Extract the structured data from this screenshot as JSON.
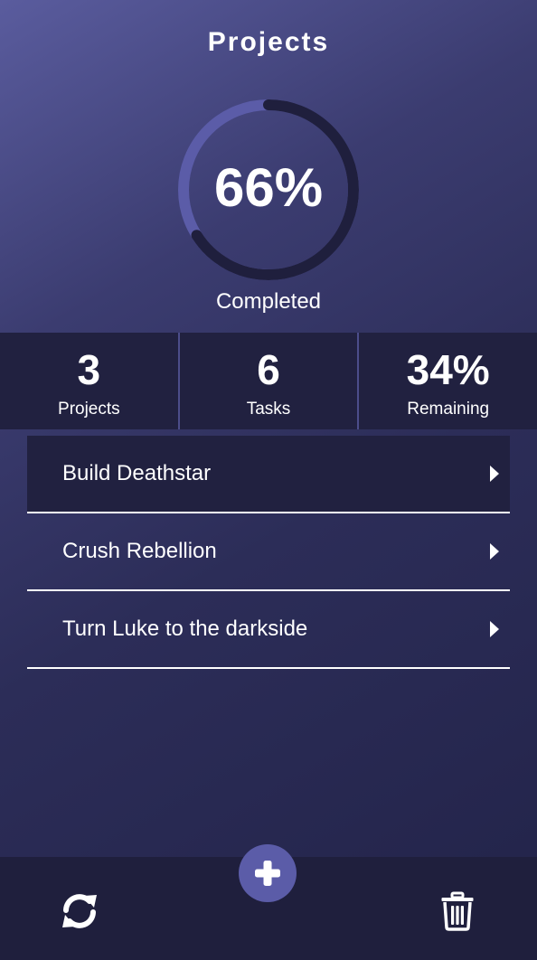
{
  "header": {
    "title": "Projects"
  },
  "progress": {
    "completed_fraction": 0.66,
    "percent_label": "66%",
    "caption": "Completed",
    "colors": {
      "track": "#5b5ca8",
      "fill": "#1f1f3d"
    }
  },
  "stats": [
    {
      "value": "3",
      "label": "Projects"
    },
    {
      "value": "6",
      "label": "Tasks"
    },
    {
      "value": "34%",
      "label": "Remaining"
    }
  ],
  "projects": [
    {
      "label": "Build Deathstar",
      "selected": true,
      "chevron_icon": "chevron-right-icon"
    },
    {
      "label": "Crush Rebellion",
      "selected": false,
      "chevron_icon": "chevron-right-icon"
    },
    {
      "label": "Turn Luke to the darkside",
      "selected": false,
      "chevron_icon": "chevron-right-icon"
    }
  ],
  "toolbar": {
    "add_icon": "plus-icon",
    "refresh_icon": "refresh-icon",
    "delete_icon": "trash-icon",
    "accent_color": "#5b5ca8"
  }
}
